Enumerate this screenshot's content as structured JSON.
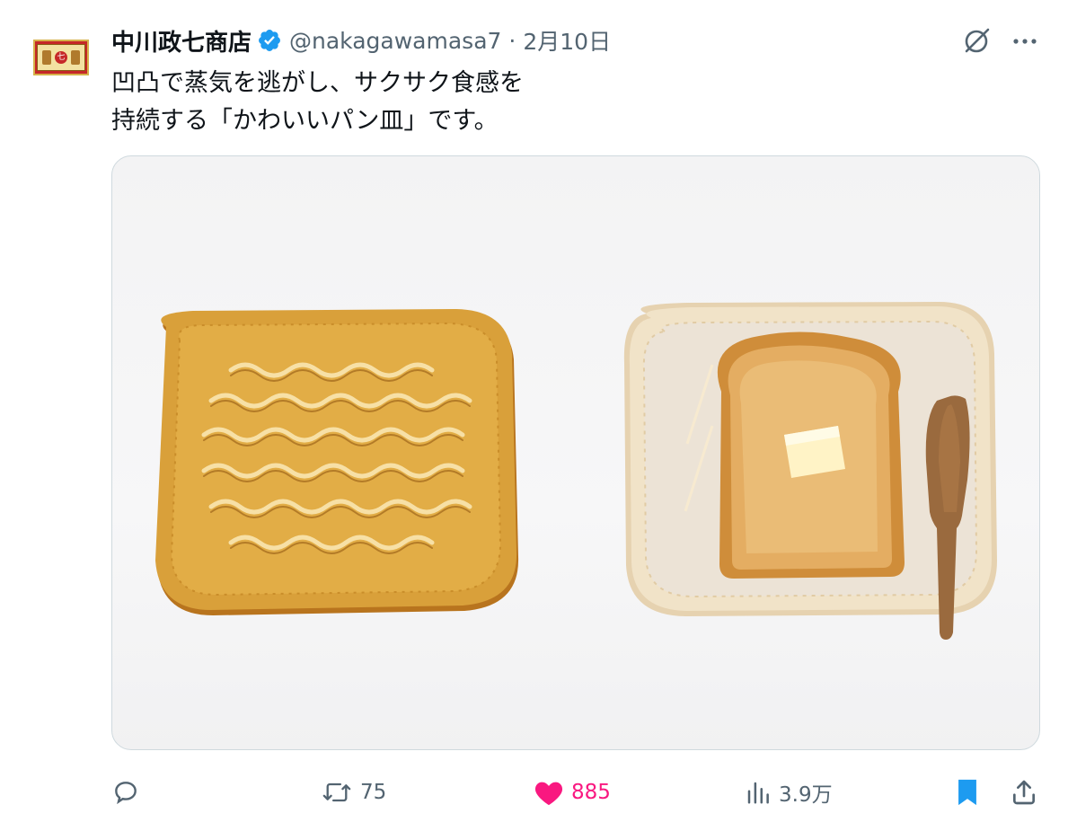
{
  "tweet": {
    "author_name": "中川政七商店",
    "handle": "@nakagawamasa7",
    "separator": "·",
    "date": "2月10日",
    "text": "凹凸で蒸気を逃がし、サクサク食感を\n持続する「かわいいパン皿」です。",
    "avatar": {
      "seal_char": "七"
    }
  },
  "icons": {
    "verified": "verified-badge-icon",
    "grok": "grok-icon",
    "more": "more-icon",
    "reply": "reply-icon",
    "retweet": "retweet-icon",
    "like": "like-icon",
    "views": "views-icon",
    "bookmark": "bookmark-icon",
    "share": "share-icon"
  },
  "actions": {
    "retweets": "75",
    "likes": "885",
    "views": "3.9万"
  },
  "colors": {
    "accent_blue": "#1d9bf0",
    "like_pink": "#f91880",
    "muted_gray": "#536471",
    "plate_amber": "#d9a03a",
    "plate_cream": "#f1e3c8"
  }
}
